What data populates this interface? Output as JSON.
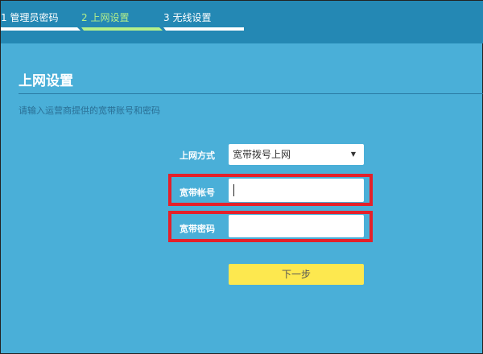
{
  "steps": [
    {
      "label": "1 管理员密码"
    },
    {
      "label": "2 上网设置"
    },
    {
      "label": "3 无线设置"
    }
  ],
  "page_title": "上网设置",
  "subtitle": "请输入运营商提供的宽带账号和密码",
  "form": {
    "mode_label": "上网方式",
    "mode_value": "宽带拨号上网",
    "account_label": "宽带帐号",
    "account_value": "",
    "password_label": "宽带密码",
    "password_value": ""
  },
  "next_button": "下一步",
  "colors": {
    "header": "#2488b4",
    "body": "#4aafd8",
    "active_step": "#b5f08a",
    "highlight": "#e4202a",
    "button": "#fde84f"
  }
}
